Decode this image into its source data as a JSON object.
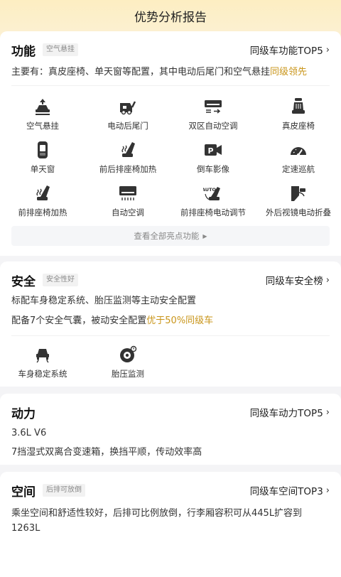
{
  "header": {
    "title": "优势分析报告"
  },
  "function": {
    "title": "功能",
    "tag": "空气悬挂",
    "rank": "同级车功能TOP5",
    "desc_prefix": "主要有：真皮座椅、单天窗等配置，其中电动后尾门和空气悬挂",
    "desc_highlight": "同级领先",
    "features": [
      {
        "label": "空气悬挂",
        "icon": "air-suspension-icon"
      },
      {
        "label": "电动后尾门",
        "icon": "power-tailgate-icon"
      },
      {
        "label": "双区自动空调",
        "icon": "dual-zone-ac-icon"
      },
      {
        "label": "真皮座椅",
        "icon": "leather-seat-icon"
      },
      {
        "label": "单天窗",
        "icon": "sunroof-icon"
      },
      {
        "label": "前后排座椅加热",
        "icon": "seat-heating-icon"
      },
      {
        "label": "倒车影像",
        "icon": "reverse-camera-icon"
      },
      {
        "label": "定速巡航",
        "icon": "cruise-control-icon"
      },
      {
        "label": "前排座椅加热",
        "icon": "front-seat-heating-icon"
      },
      {
        "label": "自动空调",
        "icon": "auto-ac-icon"
      },
      {
        "label": "前排座椅电动调节",
        "icon": "power-seat-adjust-icon"
      },
      {
        "label": "外后视镜电动折叠",
        "icon": "mirror-fold-icon"
      }
    ],
    "view_all": "查看全部亮点功能"
  },
  "safety": {
    "title": "安全",
    "tag": "安全性好",
    "rank": "同级车安全榜",
    "line1": "标配车身稳定系统、胎压监测等主动安全配置",
    "line2_prefix": "配备7个安全气囊，被动安全配置",
    "line2_highlight": "优于50%同级车",
    "features": [
      {
        "label": "车身稳定系统",
        "icon": "stability-control-icon"
      },
      {
        "label": "胎压监测",
        "icon": "tire-pressure-icon"
      }
    ]
  },
  "power": {
    "title": "动力",
    "rank": "同级车动力TOP5",
    "engine": "3.6L V6",
    "desc": "7挡湿式双离合变速箱，换挡平顺，传动效率高"
  },
  "space": {
    "title": "空间",
    "tag": "后排可放倒",
    "rank": "同级车空间TOP3",
    "desc": "乘坐空间和舒适性较好，后排可比例放倒，行李厢容积可从445L扩容到1263L"
  },
  "colors": {
    "highlight": "#c9951a",
    "header_bg": "#fdeec2"
  }
}
